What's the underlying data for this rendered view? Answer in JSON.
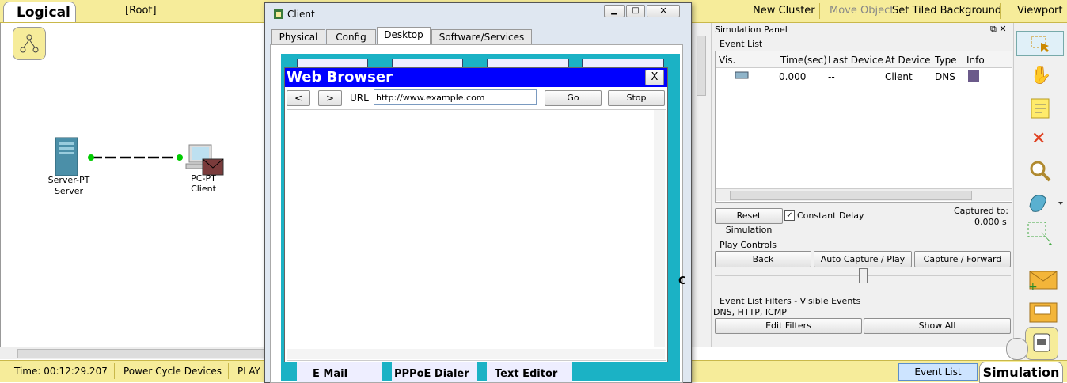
{
  "topbar": {
    "logical_label": "Logical",
    "root_label": "[Root]",
    "new_cluster": "New Cluster",
    "move_object": "Move Object",
    "set_tiled_background": "Set Tiled Background",
    "viewport": "Viewport"
  },
  "workspace": {
    "server_type": "Server-PT",
    "server_name": "Server",
    "pc_type": "PC-PT",
    "pc_name": "Client"
  },
  "client_window": {
    "title": "Client",
    "tabs": [
      "Physical",
      "Config",
      "Desktop",
      "Software/Services"
    ],
    "active_tab": "Desktop",
    "desktop_labels": [
      "E Mail",
      "PPPoE Dialer",
      "Text Editor"
    ],
    "browser": {
      "title": "Web Browser",
      "close": "X",
      "back": "<",
      "forward": ">",
      "url_label": "URL",
      "url_value": "http://www.example.com",
      "go": "Go",
      "stop": "Stop"
    }
  },
  "sim_panel": {
    "title": "Simulation Panel",
    "event_list_label": "Event List",
    "columns": [
      "Vis.",
      "Time(sec)",
      "Last Device",
      "At Device",
      "Type",
      "Info"
    ],
    "events": [
      {
        "time": "0.000",
        "last_device": "--",
        "at_device": "Client",
        "type": "DNS"
      }
    ],
    "reset_simulation": "Reset Simulation",
    "constant_delay": "Constant Delay",
    "captured_to_label": "Captured to:",
    "captured_to_value": "0.000 s",
    "play_controls_label": "Play Controls",
    "back": "Back",
    "auto_capture": "Auto Capture / Play",
    "capture_forward": "Capture / Forward",
    "filters_label": "Event List Filters - Visible Events",
    "filters_value": "DNS, HTTP, ICMP",
    "edit_filters": "Edit Filters",
    "show_all": "Show All"
  },
  "bottombar": {
    "time": "Time: 00:12:29.207",
    "power_cycle": "Power Cycle Devices",
    "play": "PLAY C",
    "event_list": "Event List",
    "simulation": "Simulation"
  },
  "colors": {
    "topbar": "#f6ec9a",
    "browser_title": "#0000ff",
    "desktop_bg": "#1bb2c5",
    "info_swatch": "#6b5a8a"
  }
}
